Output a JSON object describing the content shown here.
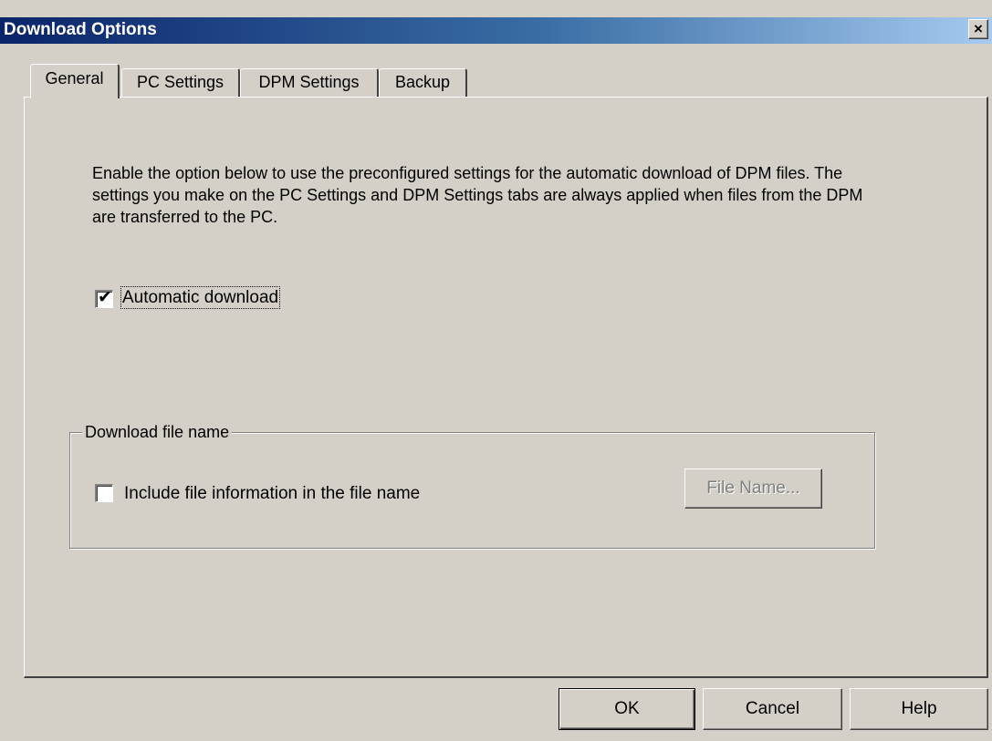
{
  "window": {
    "title": "Download Options",
    "close_label": "×"
  },
  "tabs": [
    {
      "label": "General",
      "active": true
    },
    {
      "label": "PC Settings",
      "active": false
    },
    {
      "label": "DPM Settings",
      "active": false
    },
    {
      "label": "Backup",
      "active": false
    }
  ],
  "general": {
    "description": "Enable the option below to use the preconfigured settings for the automatic download of DPM files. The settings you make on the PC Settings and DPM Settings tabs are always applied when files from the DPM are transferred to the PC.",
    "auto_download": {
      "label": "Automatic download",
      "checked": true,
      "check_glyph": "✔"
    },
    "download_file_name": {
      "legend": "Download file name",
      "include_info": {
        "label": "Include file information in the file name",
        "checked": false
      },
      "file_name_button": "File Name...",
      "file_name_button_enabled": false
    }
  },
  "footer": {
    "ok_label": "OK",
    "cancel_label": "Cancel",
    "help_label": "Help"
  }
}
